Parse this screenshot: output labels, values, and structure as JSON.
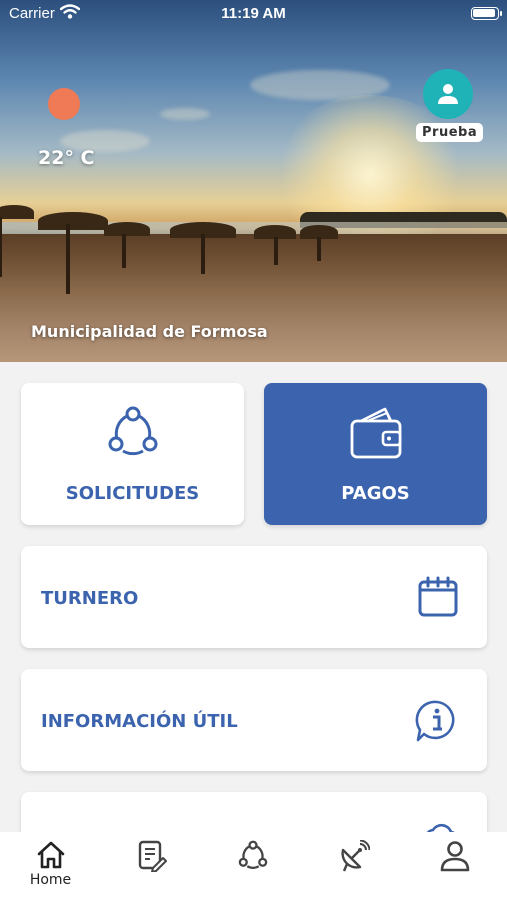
{
  "status_bar": {
    "carrier": "Carrier",
    "time": "11:19 AM"
  },
  "header": {
    "temperature": "22° C",
    "profile_name": "Prueba",
    "municipality": "Municipalidad de Formosa",
    "weather_icon": "sun-icon",
    "profile_icon": "user-icon"
  },
  "tiles": [
    {
      "label": "SOLICITUDES",
      "icon": "share-nodes-icon"
    },
    {
      "label": "PAGOS",
      "icon": "wallet-icon"
    }
  ],
  "rows": [
    {
      "label": "TURNERO",
      "icon": "calendar-icon"
    },
    {
      "label": "INFORMACIÓN ÚTIL",
      "icon": "info-bubble-icon"
    }
  ],
  "bottom_nav": [
    {
      "label": "Home",
      "icon": "home-icon",
      "active": true
    },
    {
      "label": "",
      "icon": "edit-document-icon"
    },
    {
      "label": "",
      "icon": "share-nodes-icon"
    },
    {
      "label": "",
      "icon": "satellite-dish-icon"
    },
    {
      "label": "",
      "icon": "user-icon"
    }
  ],
  "colors": {
    "primary": "#3c64ae",
    "avatar": "#1fb3b8",
    "sun": "#f07a55",
    "background": "#f2f2f2"
  }
}
